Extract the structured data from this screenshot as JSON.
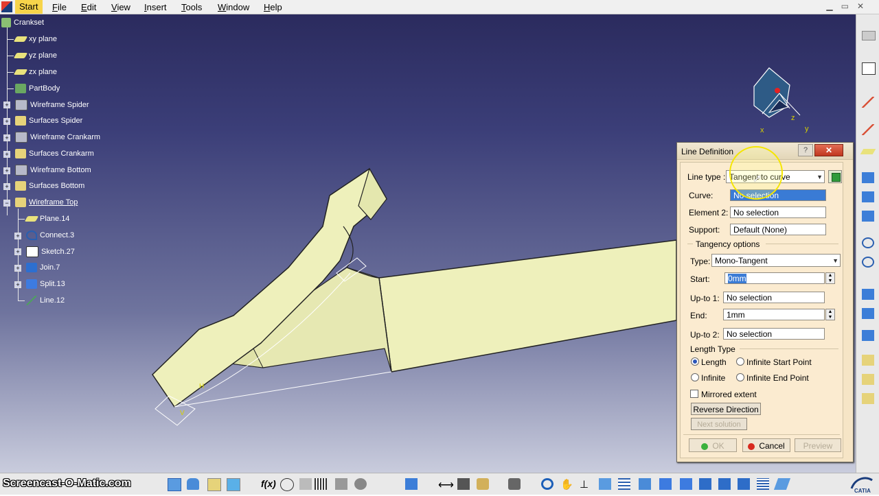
{
  "menu": {
    "items": [
      "Start",
      "File",
      "Edit",
      "View",
      "Insert",
      "Tools",
      "Window",
      "Help"
    ],
    "underline": [
      "S",
      "F",
      "E",
      "V",
      "I",
      "T",
      "W",
      "H"
    ],
    "rest": [
      "tart",
      "ile",
      "dit",
      "iew",
      "nsert",
      "ools",
      "indow",
      "elp"
    ]
  },
  "tree": {
    "root": "Crankset",
    "nodes": [
      {
        "label": "xy plane",
        "icon": "plane-icon"
      },
      {
        "label": "yz plane",
        "icon": "plane-icon"
      },
      {
        "label": "zx plane",
        "icon": "plane-icon"
      },
      {
        "label": "PartBody",
        "icon": "partbody-icon"
      },
      {
        "label": "Wireframe Spider",
        "icon": "geometrical-set-icon"
      },
      {
        "label": "Surfaces Spider",
        "icon": "surface-set-icon"
      },
      {
        "label": "Wireframe Crankarm",
        "icon": "geometrical-set-icon"
      },
      {
        "label": "Surfaces Crankarm",
        "icon": "surface-set-icon"
      },
      {
        "label": "Wireframe Bottom",
        "icon": "geometrical-set-icon"
      },
      {
        "label": "Surfaces Bottom",
        "icon": "surface-set-icon"
      },
      {
        "label": "Wireframe Top",
        "icon": "surface-set-icon"
      }
    ],
    "children": [
      {
        "label": "Plane.14",
        "icon": "plane-icon"
      },
      {
        "label": "Connect.3",
        "icon": "connect-curve-icon"
      },
      {
        "label": "Sketch.27",
        "icon": "sketch-icon"
      },
      {
        "label": "Join.7",
        "icon": "join-icon"
      },
      {
        "label": "Split.13",
        "icon": "split-icon"
      },
      {
        "label": "Line.12",
        "icon": "line-icon"
      }
    ]
  },
  "compass": {
    "x": "x",
    "y": "y",
    "z": "z"
  },
  "dialog": {
    "title": "Line Definition",
    "help": "?",
    "close": "✕",
    "line_type_label": "Line type :",
    "line_type_value": "Tangent to curve",
    "curve_label": "Curve:",
    "curve_value": "No selection",
    "element2_label": "Element 2:",
    "element2_value": "No selection",
    "support_label": "Support:",
    "support_value": "Default (None)",
    "tangency_group": "Tangency options",
    "type_label": "Type:",
    "type_value": "Mono-Tangent",
    "start_label": "Start:",
    "start_value": "0mm",
    "upto1_label": "Up-to 1:",
    "upto1_value": "No selection",
    "end_label": "End:",
    "end_value": "1mm",
    "upto2_label": "Up-to 2:",
    "upto2_value": "No selection",
    "length_type_group": "Length Type",
    "opt_length": "Length",
    "opt_infinite_start": "Infinite Start Point",
    "opt_infinite": "Infinite",
    "opt_infinite_end": "Infinite End Point",
    "mirrored": "Mirrored extent",
    "reverse": "Reverse Direction",
    "next_solution": "Next solution",
    "ok": "OK",
    "cancel": "Cancel",
    "preview": "Preview"
  },
  "watermark": "Screencast-O-Matic.com",
  "colors": {
    "part": "#eef0bb",
    "dialog_bg": "#f6e5c6",
    "selection": "#3a7bd5",
    "start_menu": "#f7d44a"
  }
}
